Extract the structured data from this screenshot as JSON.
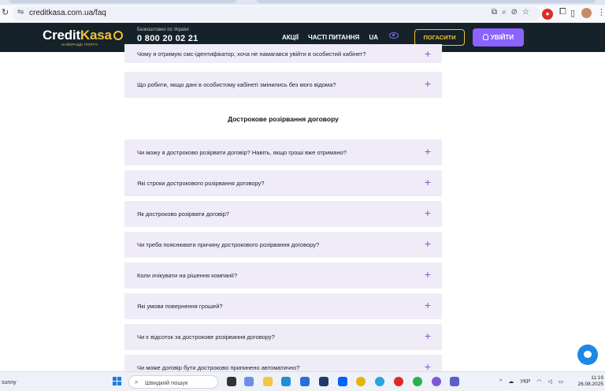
{
  "browser": {
    "url": "creditkasa.com.ua/faq"
  },
  "site_header": {
    "logo_part1": "Credit",
    "logo_part2": "Kasa",
    "logo_tagline": "НАЙКРАЩЕ ПОРУЧ",
    "phone_note": "Безкоштовно по Україні",
    "phone": "0 800 20 02 21",
    "nav": [
      "АКЦІЇ",
      "ЧАСТІ ПИТАННЯ",
      "UA"
    ],
    "pay_button": "ПОГАСИТИ",
    "login_button": "УВІЙТИ"
  },
  "faq": {
    "top_items": [
      "Чому я отримую смс-ідентифікатор, хоча не намагався увійти в особистий кабінет?",
      "Що робити, якщо дані в особистому кабінеті змінились без мого відома?"
    ],
    "section_title": "Дострокове розірвання договору",
    "section_items": [
      "Чи можу я достроково розірвати договір? Навіть, якщо гроші вже отримано?",
      "Які строки дострокового розірвання договору?",
      "Як достроково розірвати договір?",
      "Чи треба пояснювати причину дострокового розірвання договору?",
      "Коли очікувати на рішення компанії?",
      "Які умови повернення грошей?",
      "Чи є відсоток за дострокове розірвання договору?",
      "Чи може договір бути достроково припинено автоматично?"
    ],
    "expand_symbol": "+"
  },
  "taskbar": {
    "weather": "sunny",
    "search_placeholder": "Швидкий пошук",
    "language": "УКР",
    "time": "11:19",
    "date": "26.08.2025"
  },
  "colors": {
    "header_bg": "#152229",
    "accent_yellow": "#f2c233",
    "accent_purple": "#8c63ff",
    "faq_bg": "#efecf7"
  }
}
